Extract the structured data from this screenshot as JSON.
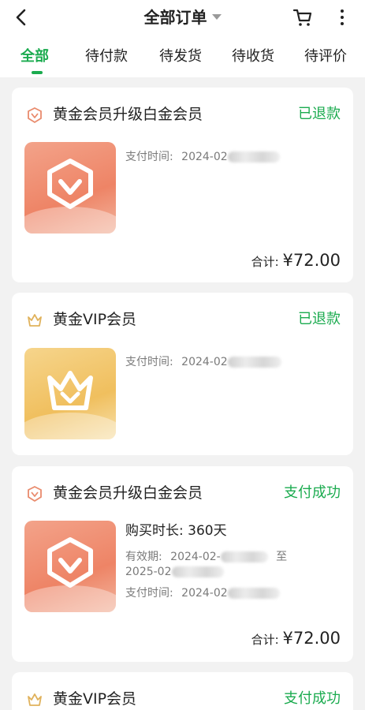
{
  "header": {
    "title": "全部订单",
    "back_icon": "back-arrow-icon",
    "cart_icon": "cart-icon",
    "more_icon": "more-vertical-icon"
  },
  "tabs": [
    {
      "label": "全部",
      "active": true
    },
    {
      "label": "待付款",
      "active": false
    },
    {
      "label": "待发货",
      "active": false
    },
    {
      "label": "待收货",
      "active": false
    },
    {
      "label": "待评价",
      "active": false
    }
  ],
  "colors": {
    "accent": "#1bab4f",
    "pink_thumb": "#ee8466",
    "gold_thumb": "#f0bf5e"
  },
  "orders": [
    {
      "title": "黄金会员升级白金会员",
      "status": "已退款",
      "pay_time_label": "支付时间:",
      "pay_time_value": "2024-02",
      "total_label": "合计:",
      "total_amount": "¥72.00"
    },
    {
      "title": "黄金VIP会员",
      "status": "已退款",
      "pay_time_label": "支付时间:",
      "pay_time_value": "2024-02"
    },
    {
      "title": "黄金会员升级白金会员",
      "status": "支付成功",
      "duration_label": "购买时长:",
      "duration_value": "360天",
      "valid_label": "有效期:",
      "valid_start": "2024-02-",
      "valid_to": "至",
      "valid_end": "2025-02",
      "pay_time_label": "支付时间:",
      "pay_time_value": "2024-02",
      "total_label": "合计:",
      "total_amount": "¥72.00"
    },
    {
      "title": "黄金VIP会员",
      "status": "支付成功"
    }
  ]
}
